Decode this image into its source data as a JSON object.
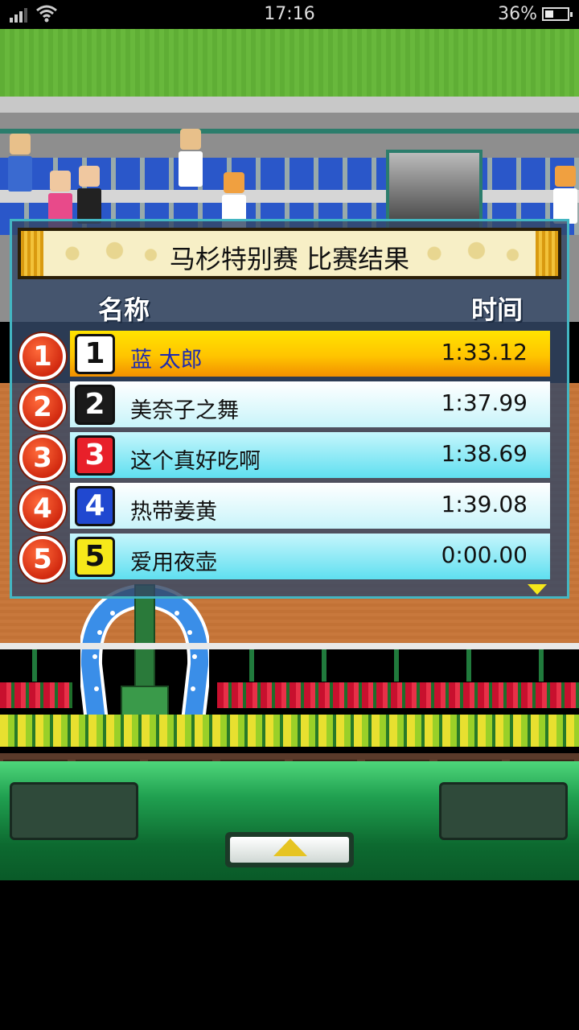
{
  "status_bar": {
    "time": "17:16",
    "battery_percent": "36%",
    "signal_icon": "signal-bars-icon",
    "wifi_icon": "wifi-icon",
    "battery_icon": "battery-icon"
  },
  "dialog": {
    "title": "马杉特别赛 比赛结果",
    "header_name": "名称",
    "header_time": "时间",
    "results": [
      {
        "rank": "1",
        "gate": "1",
        "name": "蓝 太郎",
        "time": "1:33.12",
        "gate_bg": "#ffffff",
        "gate_fg": "#111111"
      },
      {
        "rank": "2",
        "gate": "2",
        "name": "美奈子之舞",
        "time": "1:37.99",
        "gate_bg": "#1a1a1a",
        "gate_fg": "#ffffff"
      },
      {
        "rank": "3",
        "gate": "3",
        "name": "这个真好吃啊",
        "time": "1:38.69",
        "gate_bg": "#e8202a",
        "gate_fg": "#ffffff"
      },
      {
        "rank": "4",
        "gate": "4",
        "name": "热带姜黄",
        "time": "1:39.08",
        "gate_bg": "#2048d0",
        "gate_fg": "#ffffff"
      },
      {
        "rank": "5",
        "gate": "5",
        "name": "爱用夜壶",
        "time": "0:00.00",
        "gate_bg": "#f6e81a",
        "gate_fg": "#111111"
      }
    ],
    "more_icon": "scroll-down-arrow-icon"
  },
  "controls": {
    "up_button_icon": "up-arrow-icon"
  },
  "colors": {
    "first_row": "#ffd000",
    "rank_circle": "#e0401a",
    "dialog_border": "#43b6c2"
  }
}
